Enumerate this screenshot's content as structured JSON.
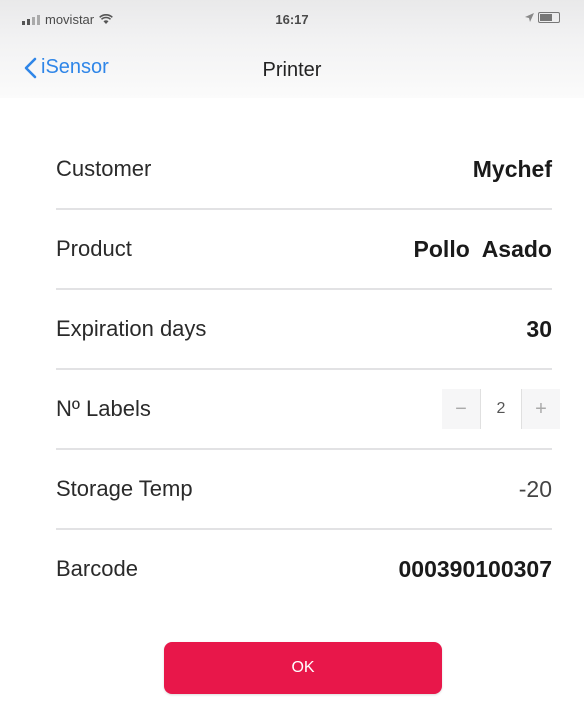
{
  "status_bar": {
    "carrier": "movistar",
    "time": "16:17"
  },
  "nav": {
    "back_label": "iSensor",
    "title": "Printer"
  },
  "form": {
    "customer": {
      "label": "Customer",
      "value": "Mychef"
    },
    "product": {
      "label": "Product",
      "value": "Pollo  Asado"
    },
    "expiration": {
      "label": "Expiration days",
      "value": "30"
    },
    "labels": {
      "label": "Nº Labels",
      "value": "2",
      "minus": "−",
      "plus": "+"
    },
    "storage_temp": {
      "label": "Storage Temp",
      "value": "-20"
    },
    "barcode": {
      "label": "Barcode",
      "value": "000390100307"
    }
  },
  "ok_button": {
    "label": "OK"
  },
  "colors": {
    "accent": "#e8174a",
    "link": "#2f86e8"
  }
}
